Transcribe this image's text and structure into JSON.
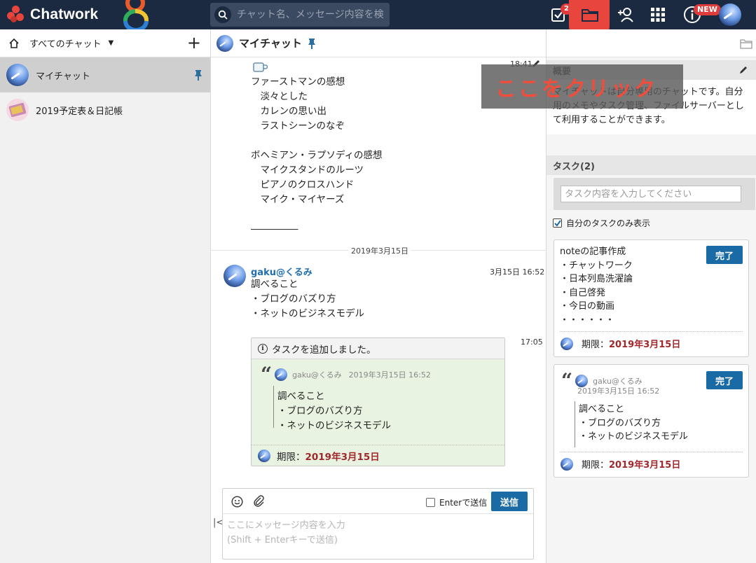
{
  "app": {
    "name": "Chatwork"
  },
  "search": {
    "placeholder": "チャット名、メッセージ内容を検索"
  },
  "topbar": {
    "task_badge": "2",
    "new_badge": "NEW"
  },
  "sidebar": {
    "filter_label": "すべてのチャット",
    "rooms": [
      {
        "name": "マイチャット",
        "pinned": true,
        "active": true
      },
      {
        "name": "2019予定表＆日記帳",
        "pinned": false,
        "active": false
      }
    ]
  },
  "chat": {
    "room_title": "マイチャット",
    "messages": [
      {
        "time": "18:41",
        "body": "ファーストマンの感想\n　淡々とした\n　カレンの思い出\n　ラストシーンのなぞ\n\nボヘミアン・ラプソディの感想\n　マイクスタンドのルーツ\n　ピアノのクロスハンド\n　マイク・マイヤーズ\n\n―――――"
      }
    ],
    "date_separator": "2019年3月15日",
    "second_message": {
      "sender": "gaku@くるみ",
      "timestamp": "3月15日 16:52",
      "body": "調べること\n・ブログのバズり方\n・ネットのビジネスモデル"
    },
    "task_card": {
      "time": "17:05",
      "header": "タスクを追加しました。",
      "quote_author": "gaku@くるみ",
      "quote_time": "2019年3月15日 16:52",
      "quote_body": "調べること\n・ブログのバズり方\n・ネットのビジネスモデル",
      "deadline_label": "期限：",
      "deadline_value": "2019年3月15日"
    },
    "composer": {
      "enter_to_send_label": "Enterで送信",
      "send_label": "送信",
      "placeholder": "ここにメッセージ内容を入力\n(Shift + Enterキーで送信)"
    }
  },
  "panel": {
    "overview_title": "概要",
    "overview_text": "マイチャットは自分専用のチャットです。自分用のメモやタスク管理、ファイルサーバーとして利用することができます。",
    "overlay_text": "ここをクリック",
    "tasks_title": "タスク(2)",
    "task_input_placeholder": "タスク内容を入力してください",
    "only_mine_label": "自分のタスクのみ表示",
    "done_label": "完了",
    "tasks": [
      {
        "body": "noteの記事作成\n・チャットワーク\n・日本列島洗濯論\n・自己啓発\n・今日の動画\n・・・・・・",
        "deadline_label": "期限：",
        "deadline_value": "2019年3月15日"
      },
      {
        "quote_author": "gaku@くるみ",
        "quote_time": "2019年3月15日 16:52",
        "body": "調べること\n・ブログのバズり方\n・ネットのビジネスモデル",
        "deadline_label": "期限：",
        "deadline_value": "2019年3月15日"
      }
    ]
  },
  "colors": {
    "topbar": "#1b2a41",
    "accent_blue": "#1a6aa6",
    "deadline_red": "#a0282b",
    "overlay_text": "#f04d3d"
  }
}
